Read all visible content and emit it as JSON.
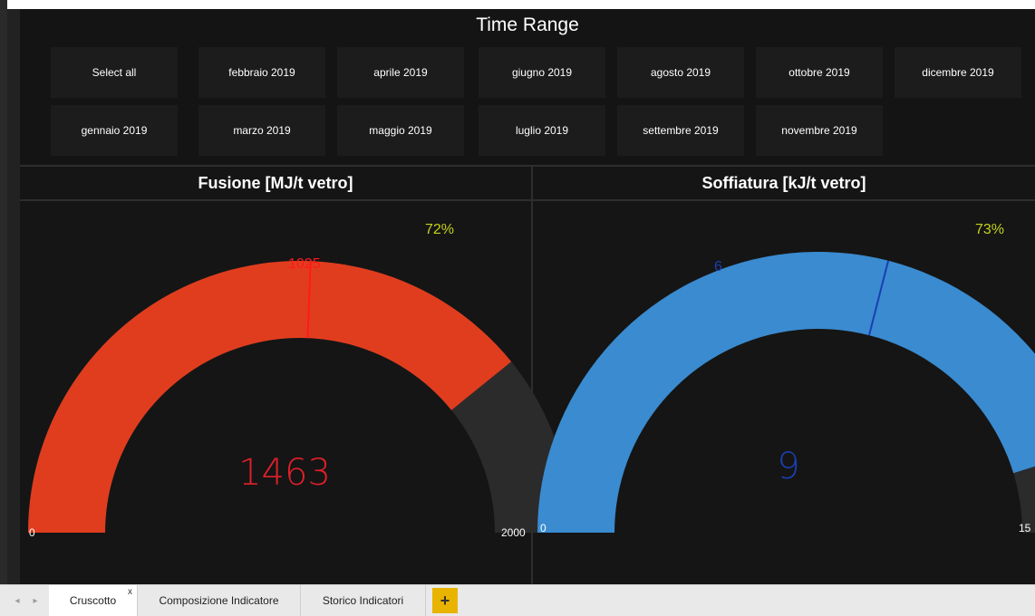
{
  "slicer": {
    "title": "Time Range",
    "row1": [
      "Select all",
      "febbraio 2019",
      "aprile 2019",
      "giugno 2019",
      "agosto 2019",
      "ottobre 2019",
      "dicembre 2019"
    ],
    "row2": [
      "gennaio 2019",
      "marzo 2019",
      "maggio 2019",
      "luglio 2019",
      "settembre 2019",
      "novembre 2019"
    ]
  },
  "gauges": [
    {
      "title": "Fusione [MJ/t vetro]",
      "percent_label": "72%",
      "value": "1463",
      "target": "1025",
      "min": "0",
      "max": "2000",
      "fill_fraction": 0.72,
      "target_fraction": 0.5125,
      "color": "#e03d1f",
      "value_color": "#e0202a",
      "target_color": "#ff1a1a"
    },
    {
      "title": "Soffiatura [kJ/t vetro]",
      "percent_label": "73%",
      "value": "9",
      "target": "6",
      "min": "0",
      "max": "15",
      "fill_fraction": 0.73,
      "target_fraction": 0.58,
      "color": "#3a8bd0",
      "value_color": "#1a3fb0",
      "target_color": "#1a3fb0"
    }
  ],
  "tabbar": {
    "tabs": [
      {
        "label": "Cruscotto",
        "close": "x"
      },
      {
        "label": "Composizione Indicatore"
      },
      {
        "label": "Storico Indicatori"
      }
    ],
    "add_label": "+",
    "prev_icon": "◂",
    "next_icon": "▸"
  }
}
